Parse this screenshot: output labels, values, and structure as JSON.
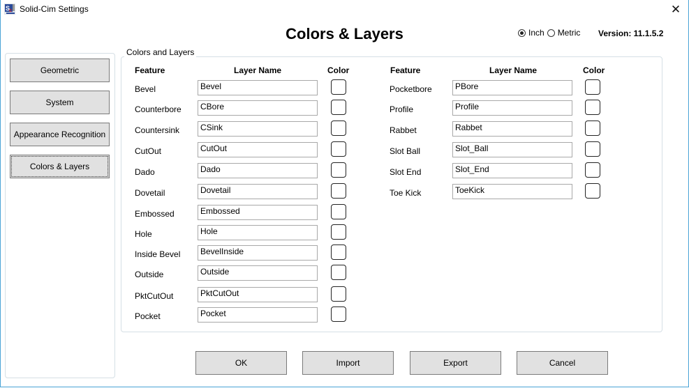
{
  "window": {
    "title": "Solid-Cim Settings",
    "close_label": "✕"
  },
  "header": {
    "heading": "Colors & Layers",
    "units": {
      "options": [
        "Inch",
        "Metric"
      ],
      "selected": "Inch"
    },
    "version": "Version: 11.1.5.2"
  },
  "sidebar": {
    "items": [
      {
        "label": "Geometric",
        "active": false
      },
      {
        "label": "System",
        "active": false
      },
      {
        "label": "Appearance Recognition",
        "active": false
      },
      {
        "label": "Colors & Layers",
        "active": true
      }
    ]
  },
  "group": {
    "legend": "Colors and Layers",
    "headers": {
      "feature": "Feature",
      "layer_name": "Layer Name",
      "color": "Color"
    },
    "left_rows": [
      {
        "feature": "Bevel",
        "layer": "Bevel"
      },
      {
        "feature": "Counterbore",
        "layer": "CBore"
      },
      {
        "feature": "Countersink",
        "layer": "CSink"
      },
      {
        "feature": "CutOut",
        "layer": "CutOut"
      },
      {
        "feature": "Dado",
        "layer": "Dado"
      },
      {
        "feature": "Dovetail",
        "layer": "Dovetail"
      },
      {
        "feature": "Embossed",
        "layer": "Embossed"
      },
      {
        "feature": "Hole",
        "layer": "Hole"
      },
      {
        "feature": "Inside Bevel",
        "layer": "BevelInside"
      },
      {
        "feature": "Outside",
        "layer": "Outside"
      },
      {
        "feature": "PktCutOut",
        "layer": "PktCutOut"
      },
      {
        "feature": "Pocket",
        "layer": "Pocket"
      }
    ],
    "right_rows": [
      {
        "feature": "Pocketbore",
        "layer": "PBore"
      },
      {
        "feature": "Profile",
        "layer": "Profile"
      },
      {
        "feature": "Rabbet",
        "layer": "Rabbet"
      },
      {
        "feature": "Slot Ball",
        "layer": "Slot_Ball"
      },
      {
        "feature": "Slot End",
        "layer": "Slot_End"
      },
      {
        "feature": "Toe Kick",
        "layer": "ToeKick"
      }
    ],
    "swatch_color": "#ffffff"
  },
  "footer": {
    "ok": "OK",
    "import": "Import",
    "export": "Export",
    "cancel": "Cancel"
  }
}
